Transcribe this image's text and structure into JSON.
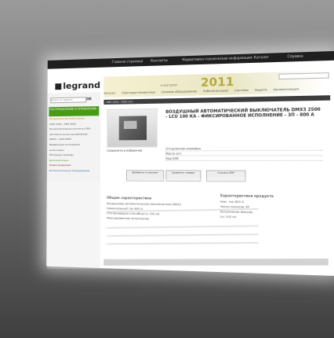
{
  "top_nav": [
    "Главная страница",
    "Контакты",
    "Нормативно-техническая информация",
    "Каталог",
    "Справка"
  ],
  "logo": "legrand",
  "banner": {
    "pretext": "e-каталог",
    "year": "2011"
  },
  "search": {
    "placeholder": ""
  },
  "tabs": [
    "Каталог",
    "Электроустановочные",
    "Силовое оборудование",
    "Кабеленесущие",
    "Системы",
    "Защита",
    "Автоматизация"
  ],
  "sidebar": {
    "search_placeholder": "Поиск по Legrand",
    "search_go": "ОК",
    "heading": "РАСПРЕДЕЛЕНИЕ И УПРАВЛЕНИЕ",
    "items": [
      {
        "text": "Воздушные автоматические",
        "cls": "ora"
      },
      {
        "text": "DMX 2500 - DMX 4000",
        "cls": ""
      },
      {
        "text": "Вспомогательные контакты DMX",
        "cls": ""
      },
      {
        "text": "Автоматические выключатели",
        "cls": ""
      },
      {
        "text": "DMX3 - 1600-4000",
        "cls": ""
      },
      {
        "text": "Выдвижные исполнения",
        "cls": ""
      },
      {
        "text": "Аксессуары",
        "cls": ""
      },
      {
        "text": "Моторные приводы",
        "cls": ""
      },
      {
        "text": "Дополнительно",
        "cls": "grn"
      },
      {
        "text": "Новая продукция",
        "cls": "red"
      },
      {
        "text": "Вспомогательное оборудование",
        "cls": "blu"
      }
    ]
  },
  "crumb": "DMX 2500 - 4000 LCU",
  "product": {
    "title": "ВОЗДУШНЫЙ АВТОМАТИЧЕСКИЙ ВЫКЛЮЧАТЕЛЬ DMX3 2500 - LCU 100 КА - ФИКСИРОВАННОЕ ИСПОЛНЕНИЕ - 3П - 800 А",
    "lines": [
      "Отгрузочная упаковка",
      "Масса (кг)",
      "Код EAN"
    ],
    "fav": "Сохранить в избранное",
    "btn_add": "Добавить в корзину",
    "btn_cmp": "Сравнить товары",
    "btn_pdf": "Скачать PDF"
  },
  "sections": {
    "left_heading": "Общие характеристики",
    "left_items": [
      "Воздушные автоматические выключатели DMX3",
      "Номинальный ток 800 А",
      "Отключающая способность 100 кА",
      "Фиксированное исполнение"
    ],
    "right_heading": "Характеристики продукта",
    "right_items": [
      "Ном. ток 800 А",
      "Число полюсов 3П",
      "Исполнение фиксир.",
      "Icu 100 кА"
    ]
  }
}
